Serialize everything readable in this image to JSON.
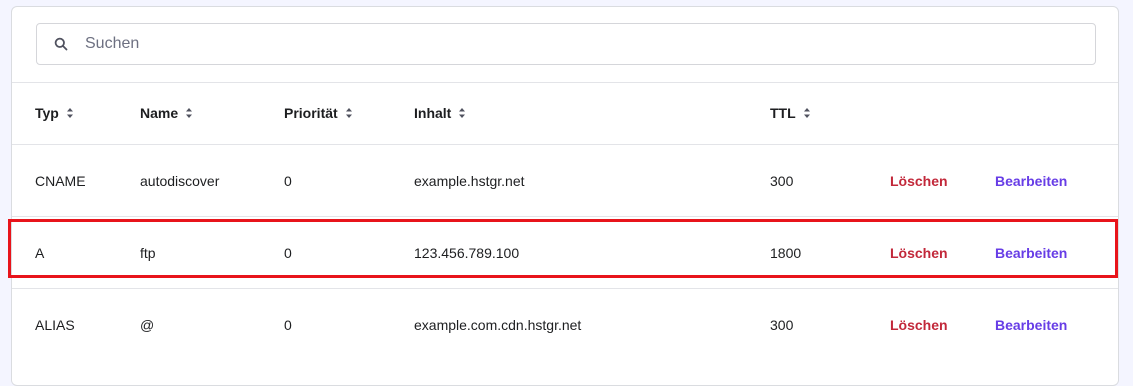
{
  "search": {
    "placeholder": "Suchen",
    "icon": "search-icon"
  },
  "table": {
    "columns": [
      {
        "key": "typ",
        "label": "Typ"
      },
      {
        "key": "name",
        "label": "Name"
      },
      {
        "key": "prio",
        "label": "Priorität"
      },
      {
        "key": "inhalt",
        "label": "Inhalt"
      },
      {
        "key": "ttl",
        "label": "TTL"
      }
    ],
    "rows": [
      {
        "typ": "CNAME",
        "name": "autodiscover",
        "prio": "0",
        "inhalt": "example.hstgr.net",
        "ttl": "300",
        "delete_label": "Löschen",
        "edit_label": "Bearbeiten"
      },
      {
        "typ": "A",
        "name": "ftp",
        "prio": "0",
        "inhalt": "123.456.789.100",
        "ttl": "1800",
        "delete_label": "Löschen",
        "edit_label": "Bearbeiten"
      },
      {
        "typ": "ALIAS",
        "name": "@",
        "prio": "0",
        "inhalt": "example.com.cdn.hstgr.net",
        "ttl": "300",
        "delete_label": "Löschen",
        "edit_label": "Bearbeiten"
      }
    ]
  },
  "colors": {
    "delete": "#c2283a",
    "edit": "#673de6",
    "highlight": "#e8141b"
  }
}
